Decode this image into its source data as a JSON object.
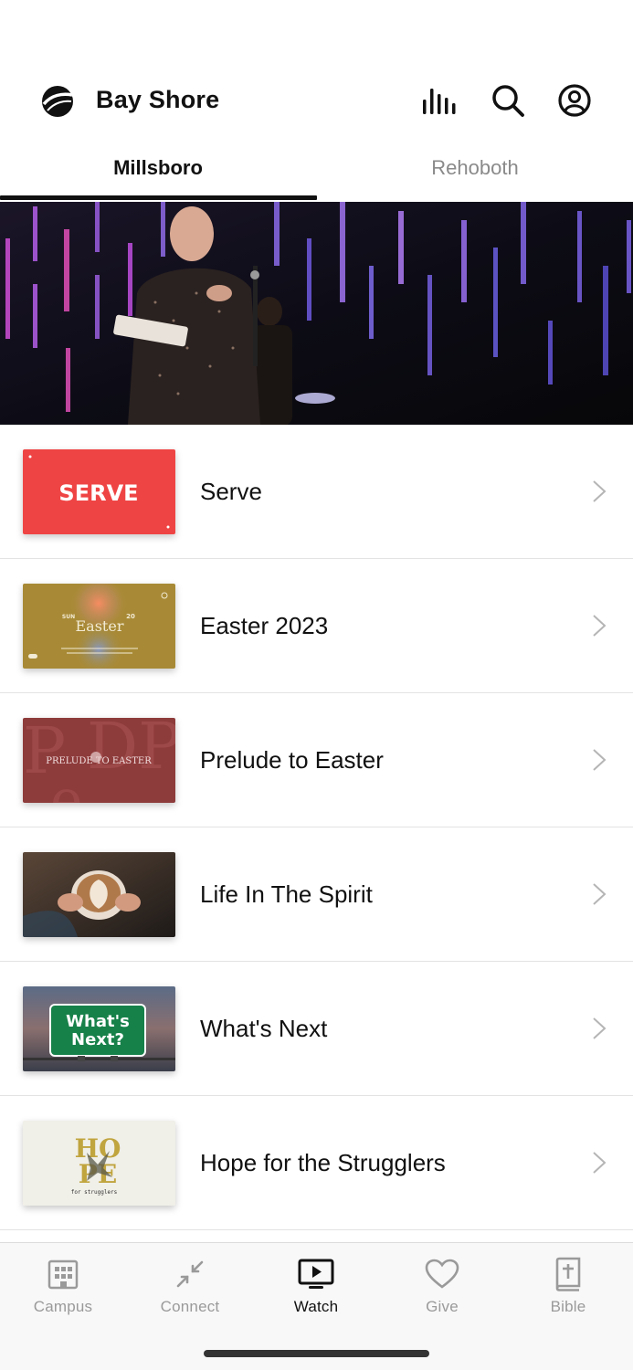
{
  "header": {
    "brand": "Bay Shore",
    "icons": [
      "church-logo-icon",
      "audio-bars-icon",
      "search-icon",
      "profile-icon"
    ]
  },
  "tabs": [
    {
      "label": "Millsboro",
      "active": true
    },
    {
      "label": "Rehoboth",
      "active": false
    }
  ],
  "hero": {
    "icon": "preacher-photo"
  },
  "series": [
    {
      "title": "Serve",
      "thumb_text": "SERVE",
      "thumb_color": "#ef4444"
    },
    {
      "title": "Easter 2023",
      "thumb_text": "Easter",
      "thumb_day": "SUN",
      "thumb_date": "20",
      "thumb_color": "#a88a36"
    },
    {
      "title": "Prelude to Easter",
      "thumb_text": "PRELUDE TO EASTER",
      "thumb_color": "#8e3b3b"
    },
    {
      "title": "Life In The Spirit",
      "thumb_color": "#3a2f28"
    },
    {
      "title": "What's Next",
      "thumb_text_1": "What's",
      "thumb_text_2": "Next?",
      "thumb_color": "#17814a"
    },
    {
      "title": "Hope for the Strugglers",
      "thumb_text_1": "HO",
      "thumb_text_2": "PE",
      "thumb_text_3": "for strugglers",
      "thumb_color": "#f0efe8"
    }
  ],
  "tabbar": {
    "items": [
      {
        "label": "Campus",
        "icon": "building-icon",
        "active": false
      },
      {
        "label": "Connect",
        "icon": "connect-arrows-icon",
        "active": false
      },
      {
        "label": "Watch",
        "icon": "tv-play-icon",
        "active": true
      },
      {
        "label": "Give",
        "icon": "heart-icon",
        "active": false
      },
      {
        "label": "Bible",
        "icon": "bible-icon",
        "active": false
      }
    ]
  },
  "colors": {
    "accent": "#111111",
    "inactive": "#9a9a9a",
    "divider": "#e3e3e3"
  }
}
